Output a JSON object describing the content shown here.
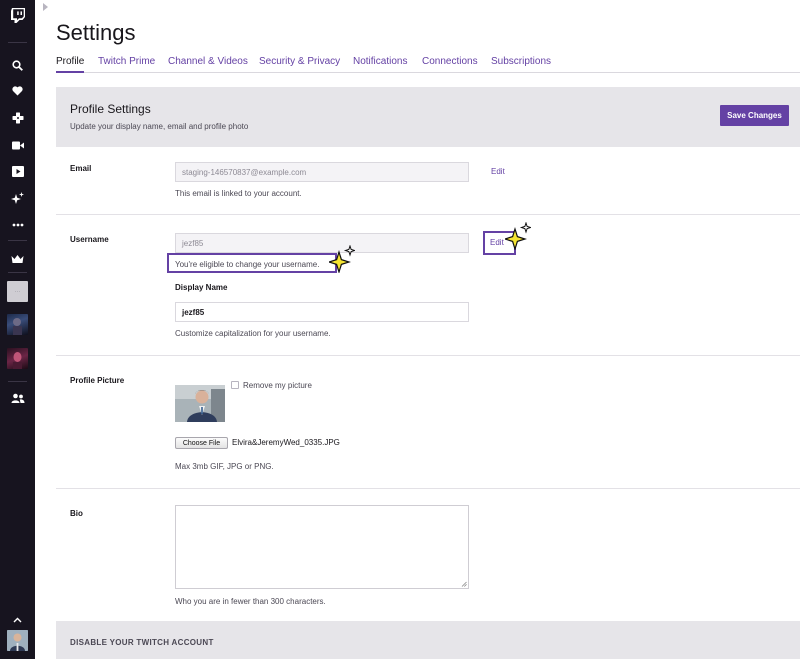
{
  "page": {
    "title": "Settings"
  },
  "tabs": [
    {
      "label": "Profile",
      "active": true
    },
    {
      "label": "Twitch Prime"
    },
    {
      "label": "Channel & Videos"
    },
    {
      "label": "Security & Privacy"
    },
    {
      "label": "Notifications"
    },
    {
      "label": "Connections"
    },
    {
      "label": "Subscriptions"
    }
  ],
  "sidebar": {
    "icons": [
      "twitch-logo-icon",
      "search-icon",
      "heart-icon",
      "gamepad-icon",
      "video-camera-icon",
      "play-icon",
      "sparkle-icon",
      "more-icon",
      "crown-icon",
      "friends-icon",
      "chevron-up-icon"
    ],
    "channels": [
      "channel-thumbnail-placeholder",
      "channel-thumbnail-dark",
      "channel-thumbnail-purple"
    ]
  },
  "profile_settings": {
    "title": "Profile Settings",
    "subtitle": "Update your display name, email and profile photo",
    "save_label": "Save Changes"
  },
  "email": {
    "label": "Email",
    "value": "staging-146570837@example.com",
    "edit_label": "Edit",
    "help": "This email is linked to your account."
  },
  "username": {
    "label": "Username",
    "value": "jezf85",
    "edit_label": "Edit",
    "eligible_text": "You're eligible to change your username."
  },
  "display_name": {
    "label": "Display Name",
    "value": "jezf85",
    "help": "Customize capitalization for your username."
  },
  "profile_picture": {
    "label": "Profile Picture",
    "remove_label": "Remove my picture",
    "choose_label": "Choose File",
    "file_name": "Elvira&JeremyWed_0335.JPG",
    "help": "Max 3mb GIF, JPG or PNG."
  },
  "bio": {
    "label": "Bio",
    "help": "Who you are in fewer than 300 characters."
  },
  "disable_account": {
    "title": "DISABLE YOUR TWITCH ACCOUNT"
  },
  "colors": {
    "accent": "#6441a4",
    "rail": "#17141f",
    "sparkle": "#f5e532"
  }
}
